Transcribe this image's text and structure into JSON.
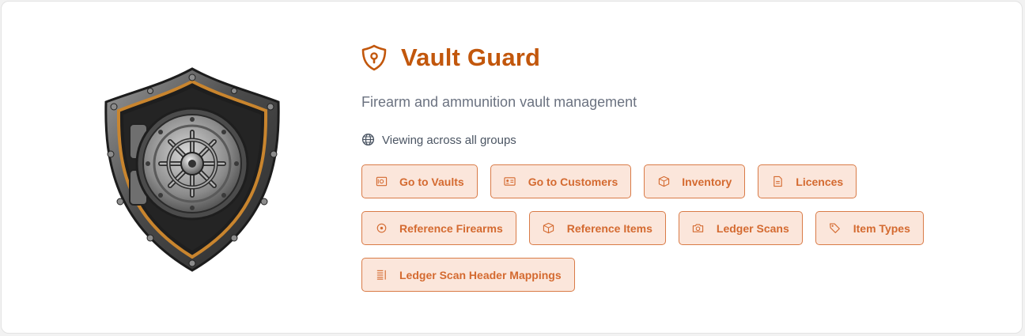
{
  "app": {
    "title": "Vault Guard",
    "subtitle": "Firearm and ammunition vault management",
    "scope_text": "Viewing across all groups"
  },
  "colors": {
    "accent": "#c2570c",
    "button_bg": "#fbe6db",
    "button_border": "#d97b47",
    "button_text": "#d46a30"
  },
  "icons": {
    "title": "shield-keyhole-icon",
    "scope": "globe-icon"
  },
  "buttons": [
    {
      "label": "Go to Vaults",
      "icon": "vault-icon"
    },
    {
      "label": "Go to Customers",
      "icon": "id-card-icon"
    },
    {
      "label": "Inventory",
      "icon": "box-icon"
    },
    {
      "label": "Licences",
      "icon": "document-icon"
    },
    {
      "label": "Reference Firearms",
      "icon": "crosshair-icon"
    },
    {
      "label": "Reference Items",
      "icon": "package-icon"
    },
    {
      "label": "Ledger Scans",
      "icon": "camera-icon"
    },
    {
      "label": "Item Types",
      "icon": "tag-icon"
    },
    {
      "label": "Ledger Scan Header Mappings",
      "icon": "list-icon"
    }
  ]
}
